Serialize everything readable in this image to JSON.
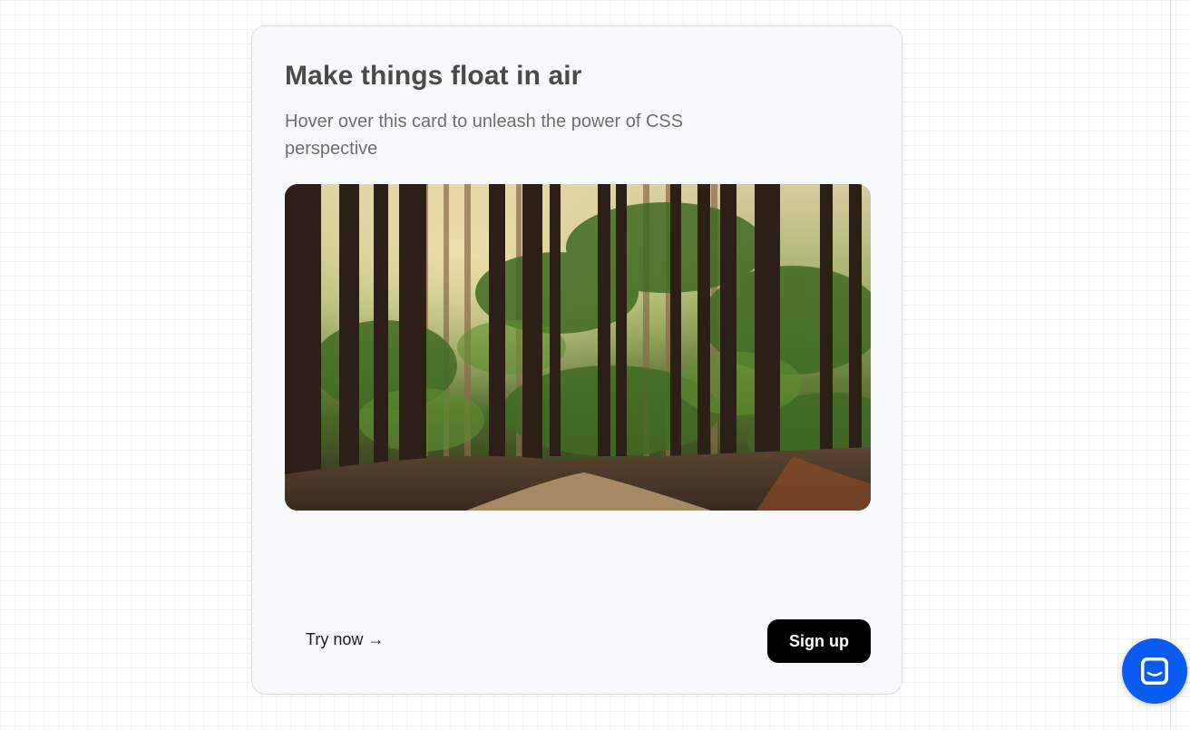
{
  "card": {
    "title": "Make things float in air",
    "description": "Hover over this card to unleash the power of CSS perspective",
    "image_icon": "forest-image",
    "try_link_label": "Try now →",
    "signup_label": "Sign up"
  },
  "chat": {
    "icon": "chat-bubble-icon",
    "color": "#0a5cf0"
  },
  "colors": {
    "card_background": "#f8f9fb",
    "button_background": "#000000",
    "button_text": "#ffffff"
  }
}
